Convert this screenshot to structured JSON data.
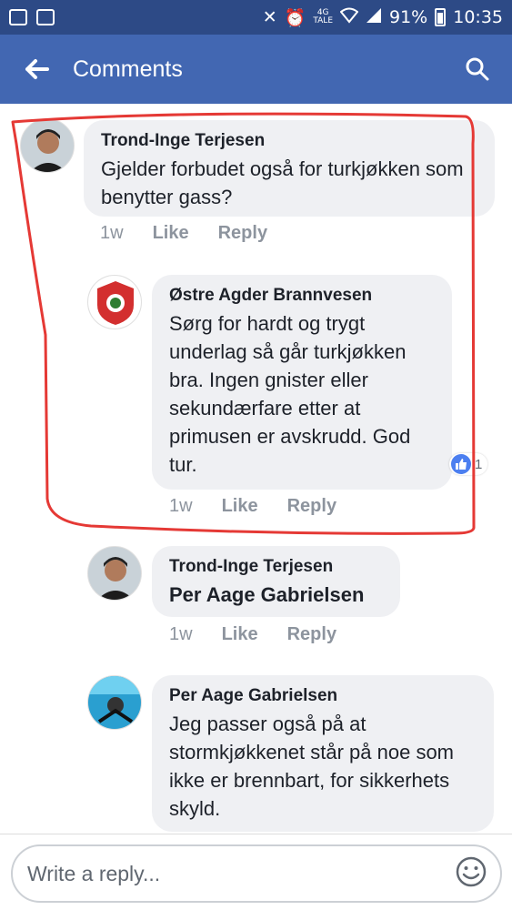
{
  "status_bar": {
    "battery": "91%",
    "time": "10:35",
    "network": "4G",
    "network_sub": "TALE"
  },
  "header": {
    "title": "Comments",
    "back_icon": "arrow-left-icon",
    "search_icon": "search-icon"
  },
  "comments": [
    {
      "author": "Trond-Inge Terjesen",
      "text": "Gjelder forbudet også for turkjøkken som benytter gass?",
      "time": "1w",
      "like": "Like",
      "reply": "Reply"
    },
    {
      "author": "Østre Agder Brannvesen",
      "text": "Sørg for hardt og trygt underlag så går turkjøkken bra. Ingen gnister eller sekundærfare etter at primusen er avskrudd. God tur.",
      "time": "1w",
      "like": "Like",
      "reply": "Reply",
      "reaction_count": "1"
    },
    {
      "author": "Trond-Inge Terjesen",
      "text": "Per Aage Gabrielsen",
      "time": "1w",
      "like": "Like",
      "reply": "Reply"
    },
    {
      "author": "Per Aage Gabrielsen",
      "text": "Jeg passer også på at stormkjøkkenet står på noe som ikke er brennbart, for sikkerhets skyld."
    }
  ],
  "reply_box": {
    "placeholder": "Write a reply..."
  },
  "colors": {
    "status_bar": "#2d4a86",
    "app_bar": "#4267b2",
    "bubble": "#eff0f3",
    "highlight": "#e53935"
  }
}
